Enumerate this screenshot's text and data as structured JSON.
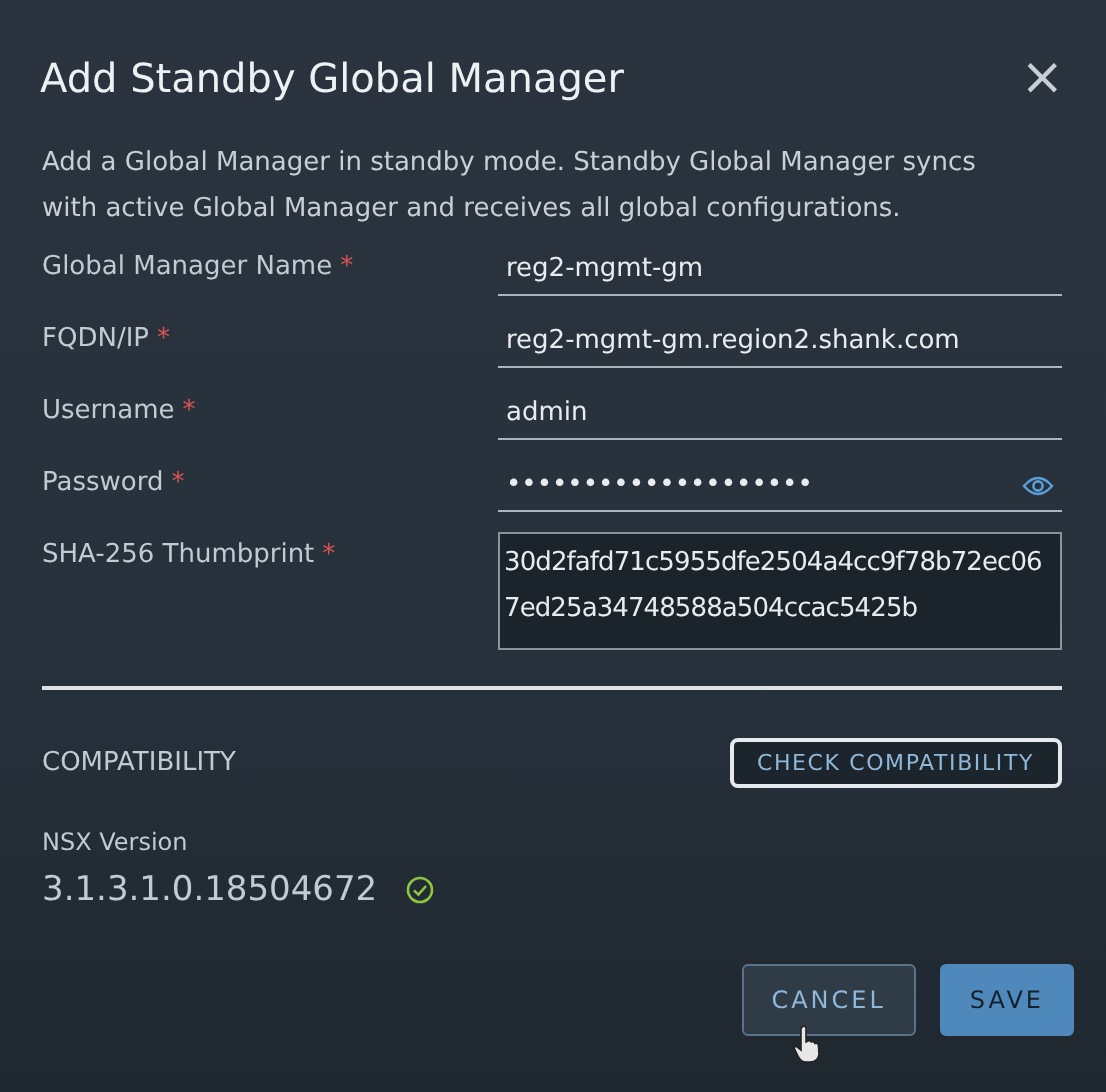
{
  "dialog": {
    "title": "Add Standby Global Manager",
    "close_icon": "×",
    "description": "Add a Global Manager in standby mode. Standby Global Manager syncs with active Global Manager and receives all global configurations."
  },
  "fields": [
    {
      "kind": "text",
      "label": "Global Manager Name",
      "required_mark": "*",
      "value": "reg2-mgmt-gm"
    },
    {
      "kind": "text",
      "label": "FQDN/IP",
      "required_mark": "*",
      "value": "reg2-mgmt-gm.region2.shank.com"
    },
    {
      "kind": "text",
      "label": "Username",
      "required_mark": "*",
      "value": "admin"
    },
    {
      "kind": "password",
      "label": "Password",
      "required_mark": "*",
      "value": "••••••••••••••••••••"
    },
    {
      "kind": "textarea",
      "label": "SHA-256 Thumbprint",
      "required_mark": "*",
      "value": "30d2fafd71c5955dfe2504a4cc9f78b72ec067ed25a34748588a504ccac5425b"
    }
  ],
  "compatibility": {
    "heading": "COMPATIBILITY",
    "button": "CHECK COMPATIBILITY",
    "version_label": "NSX Version",
    "version": "3.1.3.1.0.18504672",
    "compatible": true
  },
  "buttons": [
    {
      "kind": "outline",
      "label": "CANCEL",
      "hovered": true
    },
    {
      "kind": "primary",
      "label": "SAVE",
      "hovered": false
    }
  ]
}
